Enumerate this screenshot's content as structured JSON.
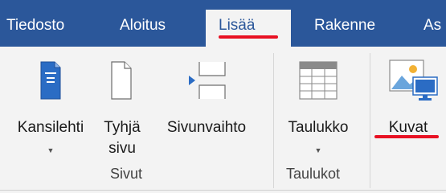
{
  "tabs": [
    {
      "label": "Tiedosto"
    },
    {
      "label": "Aloitus"
    },
    {
      "label": "Lisää"
    },
    {
      "label": "Rakenne"
    },
    {
      "label": "As"
    }
  ],
  "groups": [
    {
      "label": "Sivut"
    },
    {
      "label": "Taulukot"
    }
  ],
  "commands": {
    "cover_page": {
      "label": "Kansilehti"
    },
    "blank_page": {
      "label": "Tyhjä",
      "label2": "sivu"
    },
    "page_break": {
      "label": "Sivunvaihto"
    },
    "table": {
      "label": "Taulukko"
    },
    "pictures": {
      "label": "Kuvat"
    }
  },
  "colors": {
    "accent": "#2b579a",
    "annotation": "#e81123"
  }
}
